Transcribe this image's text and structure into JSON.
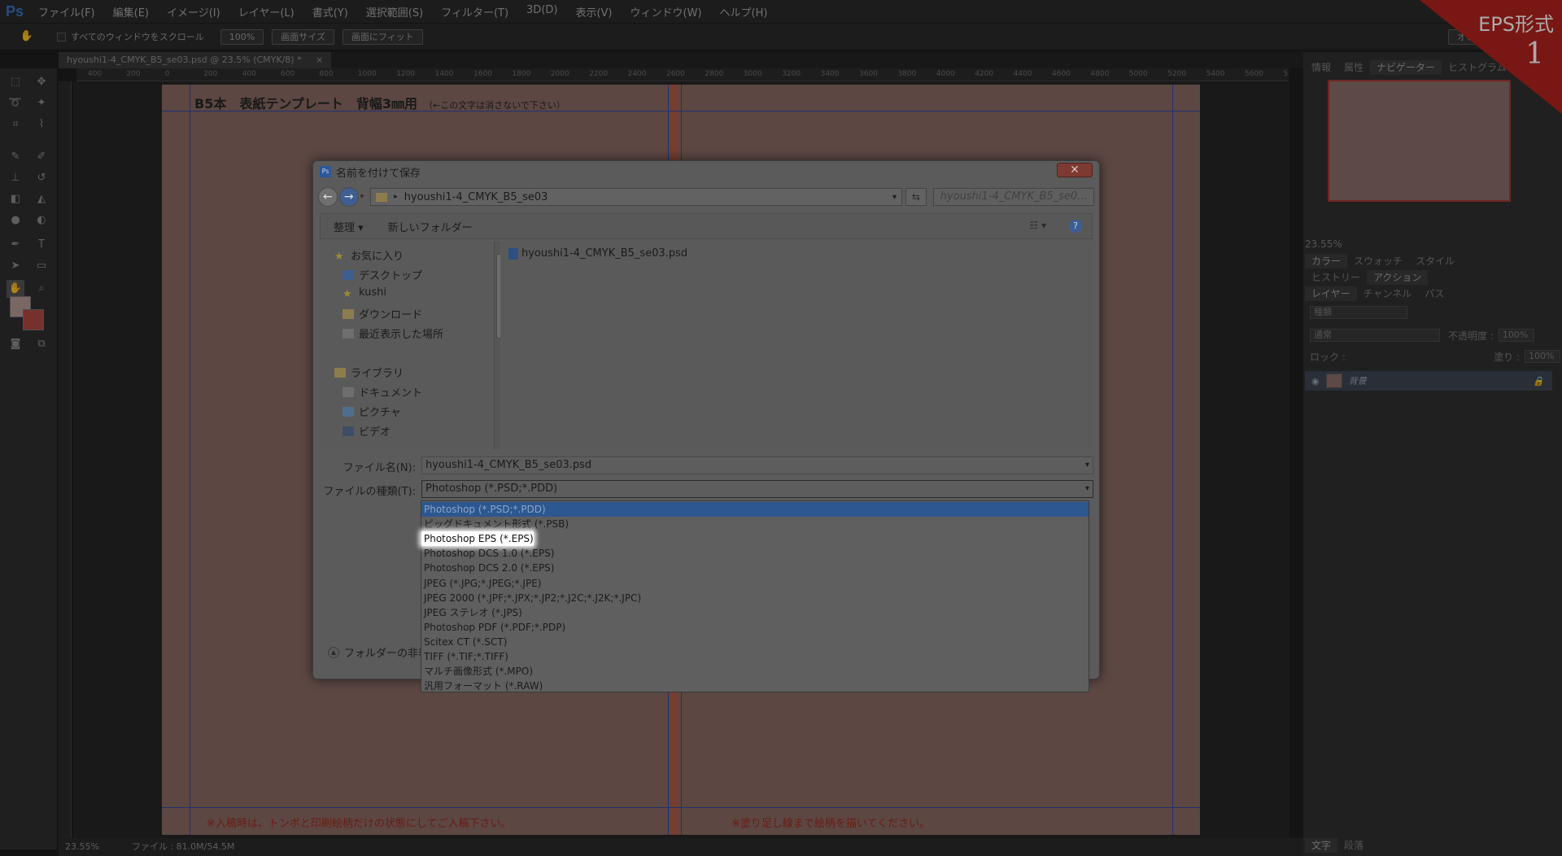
{
  "app": {
    "logo": "Ps",
    "menu": [
      "ファイル(F)",
      "編集(E)",
      "イメージ(I)",
      "レイヤー(L)",
      "書式(Y)",
      "選択範囲(S)",
      "フィルター(T)",
      "3D(D)",
      "表示(V)",
      "ウィンドウ(W)",
      "ヘルプ(H)"
    ]
  },
  "options_bar": {
    "scroll_all": "すべてのウィンドウをスクロール",
    "zoom_100": "100%",
    "fit_screen": "画面サイズ",
    "fill_screen": "画面にフィット",
    "workspace": "オレ"
  },
  "document": {
    "tab_title": "hyoushi1-4_CMYK_B5_se03.psd @ 23.5% (CMYK/8) *",
    "ruler_ticks": [
      "400",
      "200",
      "0",
      "200",
      "400",
      "600",
      "800",
      "1000",
      "1200",
      "1400",
      "1600",
      "1800",
      "2000",
      "2200",
      "2400",
      "2600",
      "2800",
      "3000",
      "3200",
      "3400",
      "3600",
      "3800",
      "4000",
      "4200",
      "4400",
      "4600",
      "4800",
      "5000",
      "5200",
      "5400",
      "5600",
      "58"
    ],
    "page_title": "B5本　表紙テンプレート　背幅3㎜用",
    "page_title_note": "（←この文字は消さないで下さい）",
    "note_left": "※入稿時は、トンボと印刷絵柄だけの状態にしてご入稿下さい。",
    "note_right": "※塗り足し線まで絵柄を描いてください。"
  },
  "status": {
    "zoom": "23.55%",
    "file_info": "ファイル : 81.0M/54.5M"
  },
  "panels": {
    "tabs_top": [
      "情報",
      "属性",
      "ナビゲーター",
      "ヒストグラム"
    ],
    "nav_zoom": "23.55%",
    "tabs_color": [
      "カラー",
      "スウォッチ",
      "スタイル"
    ],
    "tabs_history": [
      "ヒストリー",
      "アクション"
    ],
    "tabs_layers": [
      "レイヤー",
      "チャンネル",
      "パス"
    ],
    "filter_kind": "種類",
    "blend_mode": "通常",
    "opacity_label": "不透明度 :",
    "opacity_value": "100%",
    "lock_label": "ロック :",
    "fill_label": "塗り :",
    "fill_value": "100%",
    "layer_name": "背景",
    "tabs_bottom": [
      "文字",
      "段落"
    ]
  },
  "badge": {
    "title": "EPS形式",
    "step": "1"
  },
  "dialog": {
    "title": "名前を付けて保存",
    "close": "✕",
    "address": "hyoushi1-4_CMYK_B5_se03",
    "search_placeholder": "hyoushi1-4_CMYK_B5_se0...",
    "organize": "整理 ▾",
    "new_folder": "新しいフォルダー",
    "help": "?",
    "tree": {
      "favorites": "お気に入り",
      "desktop": "デスクトップ",
      "user": "kushi",
      "downloads": "ダウンロード",
      "recent": "最近表示した場所",
      "libraries": "ライブラリ",
      "documents": "ドキュメント",
      "pictures": "ピクチャ",
      "videos": "ビデオ"
    },
    "file_item": "hyoushi1-4_CMYK_B5_se03.psd",
    "filename_label": "ファイル名(N):",
    "filename_value": "hyoushi1-4_CMYK_B5_se03.psd",
    "filetype_label": "ファイルの種類(T):",
    "filetype_value": "Photoshop (*.PSD;*.PDD)",
    "hide_folders": "フォルダーの非表",
    "type_options": [
      "Photoshop (*.PSD;*.PDD)",
      "ビッグドキュメント形式 (*.PSB)",
      "Photoshop EPS (*.EPS)",
      "Photoshop DCS 1.0 (*.EPS)",
      "Photoshop DCS 2.0 (*.EPS)",
      "JPEG (*.JPG;*.JPEG;*.JPE)",
      "JPEG 2000 (*.JPF;*.JPX;*.JP2;*.J2C;*.J2K;*.JPC)",
      "JPEG ステレオ (*.JPS)",
      "Photoshop PDF (*.PDF;*.PDP)",
      "Scitex CT (*.SCT)",
      "TIFF (*.TIF;*.TIFF)",
      "マルチ画像形式 (*.MPO)",
      "汎用フォーマット (*.RAW)"
    ],
    "selected_index": 0,
    "highlight_index": 2
  },
  "colors": {
    "accent_badge": "#b5231f",
    "selection": "#2c5790"
  }
}
